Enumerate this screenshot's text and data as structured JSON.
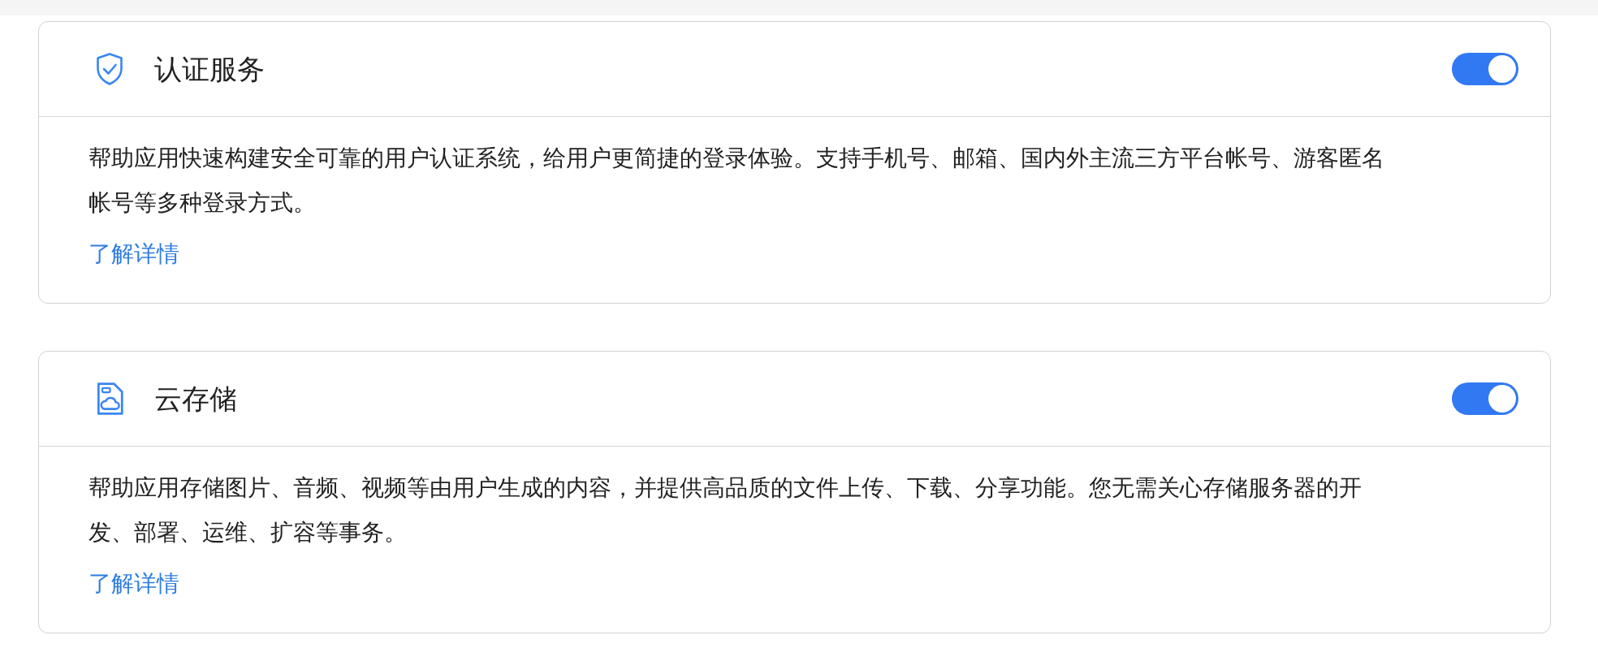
{
  "services": [
    {
      "kind": "auth",
      "title": "认证服务",
      "enabled": true,
      "description": "帮助应用快速构建安全可靠的用户认证系统，给用户更简捷的登录体验。支持手机号、邮箱、国内外主流三方平台帐号、游客匿名帐号等多种登录方式。",
      "link": "了解详情"
    },
    {
      "kind": "storage",
      "title": "云存储",
      "enabled": true,
      "description": "帮助应用存储图片、音频、视频等由用户生成的内容，并提供高品质的文件上传、下载、分享功能。您无需关心存储服务器的开发、部署、运维、扩容等事务。",
      "link": "了解详情"
    }
  ]
}
